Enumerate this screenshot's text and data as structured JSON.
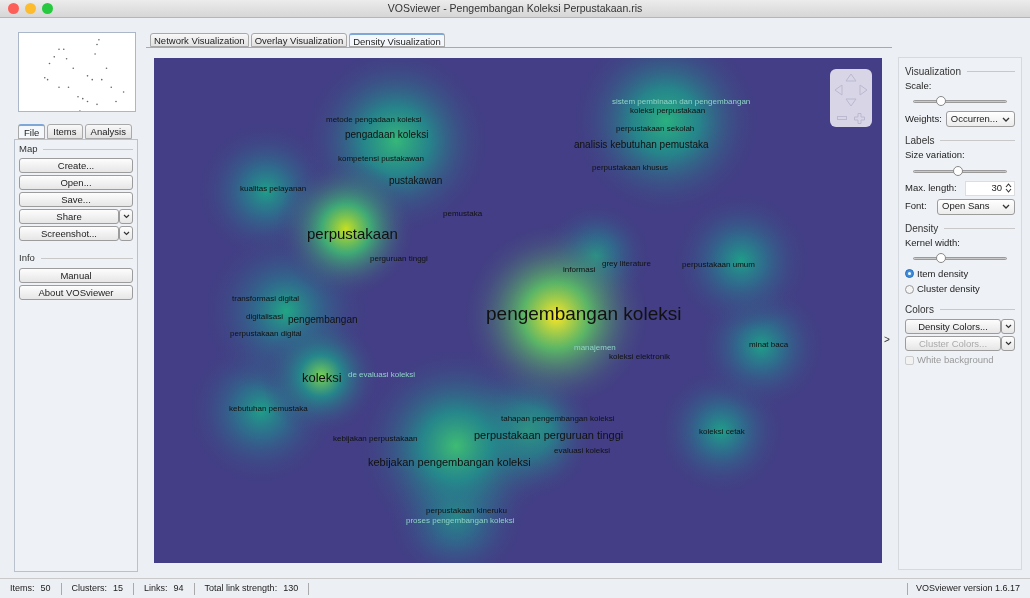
{
  "window": {
    "title": "VOSviewer - Pengembangan Koleksi Perpustakaan.ris"
  },
  "left_tabs": [
    {
      "label": "File",
      "selected": true
    },
    {
      "label": "Items",
      "selected": false
    },
    {
      "label": "Analysis",
      "selected": false
    }
  ],
  "sections": [
    {
      "title": "Map",
      "buttons": [
        {
          "label": "Create...",
          "dropdown": false
        },
        {
          "label": "Open...",
          "dropdown": false
        },
        {
          "label": "Save...",
          "dropdown": false
        },
        {
          "label": "Share",
          "dropdown": true
        },
        {
          "label": "Screenshot...",
          "dropdown": true
        }
      ]
    },
    {
      "title": "Info",
      "buttons": [
        {
          "label": "Manual",
          "dropdown": false
        },
        {
          "label": "About VOSviewer",
          "dropdown": false
        }
      ]
    }
  ],
  "view_tabs": [
    {
      "label": "Network Visualization",
      "selected": false
    },
    {
      "label": "Overlay Visualization",
      "selected": false
    },
    {
      "label": "Density Visualization",
      "selected": true
    }
  ],
  "map": {
    "labels": [
      {
        "text": "metode pengadaan koleksi",
        "dim": false
      },
      {
        "text": "pengadaan koleksi",
        "dim": false
      },
      {
        "text": "kompetensi pustakawan",
        "dim": false
      },
      {
        "text": "pustakawan",
        "dim": false
      },
      {
        "text": "kualitas pelayanan",
        "dim": false
      },
      {
        "text": "pemustaka",
        "dim": false
      },
      {
        "text": "perpustakaan",
        "dim": false
      },
      {
        "text": "perguruan tinggi",
        "dim": false
      },
      {
        "text": "sistem pembinaan dan pengembangan",
        "dim": true
      },
      {
        "text": "koleksi perpustakaan",
        "dim": false
      },
      {
        "text": "perpustakaan sekolah",
        "dim": false
      },
      {
        "text": "analisis kebutuhan pemustaka",
        "dim": false
      },
      {
        "text": "perpustakaan khusus",
        "dim": false
      },
      {
        "text": "informasi",
        "dim": false
      },
      {
        "text": "grey literature",
        "dim": false
      },
      {
        "text": "perpustakaan umum",
        "dim": false
      },
      {
        "text": "pengembangan koleksi",
        "dim": false
      },
      {
        "text": "transformasi digital",
        "dim": false
      },
      {
        "text": "digitalisasi",
        "dim": false
      },
      {
        "text": "pengembangan",
        "dim": false
      },
      {
        "text": "perpustakaan digital",
        "dim": false
      },
      {
        "text": "manajemen",
        "dim": true
      },
      {
        "text": "koleksi elektronik",
        "dim": false
      },
      {
        "text": "minat baca",
        "dim": false
      },
      {
        "text": "de evaluasi koleksi",
        "dim": true
      },
      {
        "text": "koleksi",
        "dim": false
      },
      {
        "text": "kebutuhan pemustaka",
        "dim": false
      },
      {
        "text": "tahapan pengembangan koleksi",
        "dim": false
      },
      {
        "text": "perpustakaan perguruan tinggi",
        "dim": false
      },
      {
        "text": "koleksi cetak",
        "dim": false
      },
      {
        "text": "kebijakan perpustakaan",
        "dim": false
      },
      {
        "text": "evaluasi koleksi",
        "dim": false
      },
      {
        "text": "kebijakan pengembangan koleksi",
        "dim": false
      },
      {
        "text": "perpustakaan kineruku",
        "dim": false
      },
      {
        "text": "proses pengembangan koleksi",
        "dim": true
      }
    ]
  },
  "right_panel": {
    "visualization": {
      "title": "Visualization",
      "scale_label": "Scale:",
      "scale": {
        "level": 0.3
      },
      "weights_label": "Weights:",
      "weights_value": "Occurren..."
    },
    "labels": {
      "title": "Labels",
      "size_label": "Size variation:",
      "size": {
        "level": 0.48
      },
      "max_length_label": "Max. length:",
      "max_length": "30",
      "font_label": "Font:",
      "font_value": "Open Sans"
    },
    "density": {
      "title": "Density",
      "kernel_label": "Kernel width:",
      "kernel": {
        "level": 0.3
      },
      "options": [
        {
          "label": "Item density",
          "selected": true
        },
        {
          "label": "Cluster density",
          "selected": false
        }
      ]
    },
    "colors": {
      "title": "Colors",
      "buttons": [
        {
          "label": "Density Colors...",
          "disabled": false
        },
        {
          "label": "Cluster Colors...",
          "disabled": true
        }
      ],
      "white_background": {
        "label": "White background",
        "checked": false,
        "disabled": true
      }
    }
  },
  "expand_arrow": ">",
  "status": [
    {
      "label": "Items:",
      "value": "50"
    },
    {
      "label": "Clusters:",
      "value": "15"
    },
    {
      "label": "Links:",
      "value": "94"
    },
    {
      "label": "Total link strength:",
      "value": "130"
    }
  ],
  "version": "VOSviewer version 1.6.17"
}
